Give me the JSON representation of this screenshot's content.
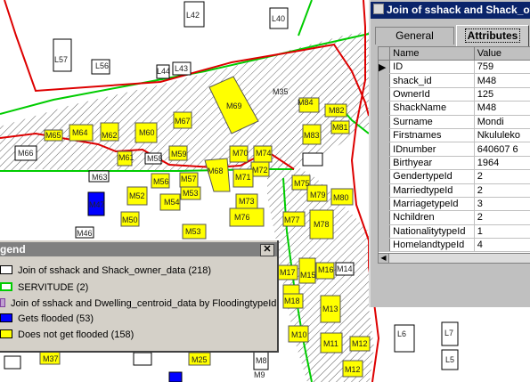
{
  "map": {
    "parcel_labels": [
      "L42",
      "L40",
      "L57",
      "L56",
      "L44",
      "L43",
      "M35",
      "M69",
      "M84",
      "M82",
      "M81",
      "M67",
      "M62",
      "M65",
      "M64",
      "M60",
      "M83",
      "M66",
      "M61",
      "M58",
      "M59",
      "M70",
      "M74",
      "M68",
      "M63",
      "M72",
      "M71",
      "M75",
      "M79",
      "M80",
      "M47",
      "M52",
      "M56",
      "M57",
      "M54",
      "M53",
      "M73",
      "M50",
      "M76",
      "M77",
      "M78",
      "M46",
      "M53",
      "M17",
      "M16",
      "M15",
      "M14",
      "M18",
      "M13",
      "M10",
      "M11",
      "M12",
      "L6",
      "L7",
      "L5",
      "M37",
      "M25",
      "M8",
      "M9",
      "M12"
    ]
  },
  "attributes_window": {
    "title": "Join of sshack and Shack_owner_data",
    "tabs": [
      "General",
      "Attributes"
    ],
    "columns": [
      "Name",
      "Value"
    ],
    "rows": [
      {
        "name": "ID",
        "value": "759"
      },
      {
        "name": "shack_id",
        "value": "M48"
      },
      {
        "name": "OwnerId",
        "value": "125"
      },
      {
        "name": "ShackName",
        "value": "M48"
      },
      {
        "name": "Surname",
        "value": "Mondi"
      },
      {
        "name": "Firstnames",
        "value": "Nkululeko"
      },
      {
        "name": "IDnumber",
        "value": "640607 6"
      },
      {
        "name": "Birthyear",
        "value": "1964"
      },
      {
        "name": "GendertypeId",
        "value": "2"
      },
      {
        "name": "MarriedtypeId",
        "value": "2"
      },
      {
        "name": "MarriagetypeId",
        "value": "3"
      },
      {
        "name": "Nchildren",
        "value": "2"
      },
      {
        "name": "NationalitytypeId",
        "value": "1"
      },
      {
        "name": "HomelandtypeId",
        "value": "4"
      }
    ]
  },
  "legend_window": {
    "title": "gend",
    "close": "✕",
    "items": [
      {
        "label": "Join of sshack and Shack_owner_data  (218)",
        "swatch": "#ffffff",
        "border": "#000000"
      },
      {
        "label": "SERVITUDE  (2)",
        "swatch": "#ffffff",
        "border": "#00cc00"
      },
      {
        "label": "Join of sshack and Dwelling_centroid_data by FloodingtypeId",
        "swatch": "#c0c0c0",
        "border": "#8040a0"
      },
      {
        "label": "Gets flooded  (53)",
        "swatch": "#0000ff",
        "border": "#000000"
      },
      {
        "label": "Does not get flooded  (158)",
        "swatch": "#ffff00",
        "border": "#000000"
      }
    ]
  },
  "colors": {
    "flooded": "#0000ff",
    "not_flooded": "#ffff00",
    "servitude": "#00cc00",
    "flood_line": "#dd0000",
    "title_active": "#0a246a"
  }
}
